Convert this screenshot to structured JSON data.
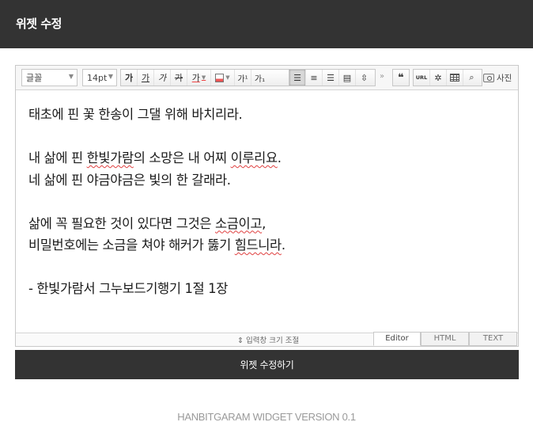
{
  "header": {
    "title": "위젯 수정"
  },
  "toolbar": {
    "font_select": "글꼴",
    "size_select": "14pt",
    "format_buttons": [
      {
        "label": "가",
        "name": "bold-button"
      },
      {
        "label": "가",
        "name": "underline-button"
      },
      {
        "label": "가",
        "name": "italic-button"
      },
      {
        "label": "가",
        "name": "strikethrough-button"
      },
      {
        "label": "가",
        "name": "font-color-button"
      }
    ],
    "sup_label": "가¹",
    "sub_label": "가₁",
    "more_label": "»",
    "url_label": "URL",
    "photo_label": "사진"
  },
  "document": {
    "lines": [
      "태초에 핀 꽃 한송이 그댈 위해 바치리라.",
      "",
      "내 삶에 핀 한빛가람의 소망은 내 어찌 이루리요.",
      "네 삶에 핀 야금야금은 빛의 한 갈래라.",
      "",
      "삶에 꼭 필요한 것이 있다면 그것은 소금이고,",
      "비밀번호에는 소금을 쳐야 해커가 뚫기 힘드니라.",
      "",
      "- 한빛가람서 그누보드기행기 1절 1장"
    ]
  },
  "statusbar": {
    "resize_label": "⇕ 입력창 크기 조절",
    "tabs": [
      "Editor",
      "HTML",
      "TEXT"
    ],
    "active_tab": "Editor"
  },
  "submit": {
    "label": "위젯 수정하기"
  },
  "footer": {
    "version": "HANBITGARAM WIDGET VERSION 0.1"
  }
}
